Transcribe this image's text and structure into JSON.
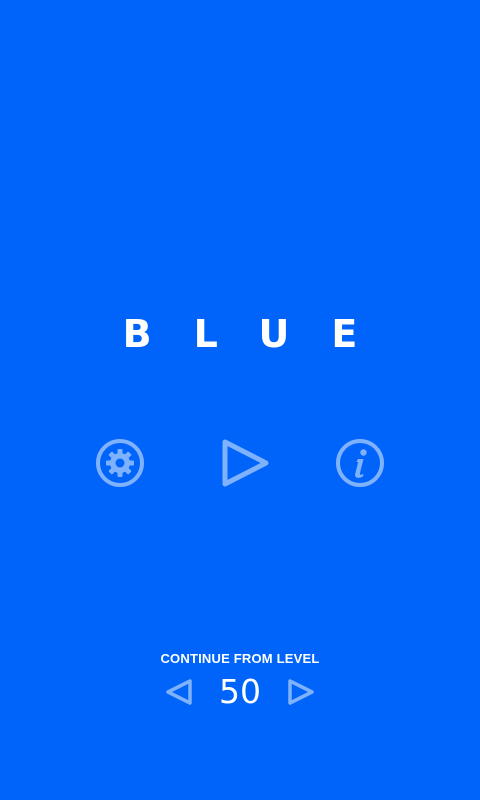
{
  "game": {
    "title": "BLUE",
    "background_color": "#0064FA",
    "icon_color": "#7FB2FD"
  },
  "menu": {
    "buttons": [
      {
        "icon": "gear-icon"
      },
      {
        "icon": "play-icon"
      },
      {
        "icon": "info-icon"
      }
    ]
  },
  "level_selector": {
    "label": "CONTINUE FROM LEVEL",
    "level": "50",
    "prev_icon": "left-triangle-icon",
    "next_icon": "right-triangle-icon"
  }
}
